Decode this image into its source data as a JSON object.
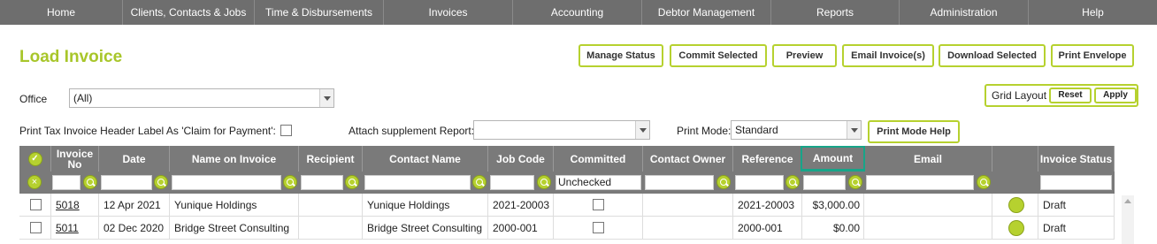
{
  "nav": [
    {
      "label": "Home",
      "w": 139
    },
    {
      "label": "Clients, Contacts & Jobs",
      "w": 149
    },
    {
      "label": "Time & Disbursements",
      "w": 146
    },
    {
      "label": "Invoices",
      "w": 146
    },
    {
      "label": "Accounting",
      "w": 146
    },
    {
      "label": "Debtor Management",
      "w": 146
    },
    {
      "label": "Reports",
      "w": 145
    },
    {
      "label": "Administration",
      "w": 146
    },
    {
      "label": "Help",
      "w": 145
    }
  ],
  "page_title": "Load Invoice",
  "toolbar": {
    "manage_status": "Manage Status",
    "commit_selected": "Commit Selected",
    "preview": "Preview",
    "email_invoices": "Email Invoice(s)",
    "download_selected": "Download Selected",
    "print_envelope": "Print Envelope"
  },
  "grid_layout": {
    "label": "Grid Layout",
    "reset": "Reset",
    "apply": "Apply"
  },
  "filters": {
    "office_label": "Office",
    "office_value": "(All)",
    "claim_label": "Print Tax Invoice Header Label As 'Claim for Payment':",
    "supplement_label": "Attach supplement Report:",
    "supplement_value": "",
    "print_mode_label": "Print Mode:",
    "print_mode_value": "Standard",
    "print_mode_help": "Print Mode Help"
  },
  "grid": {
    "columns": [
      "",
      "Invoice No",
      "Date",
      "Name on Invoice",
      "Recipient",
      "Contact Name",
      "Job Code",
      "Committed",
      "Contact Owner",
      "Reference",
      "Amount",
      "Email",
      "",
      "Invoice Status"
    ],
    "committed_filter": "Unchecked",
    "rows": [
      {
        "invoice_no": "5018",
        "date": "12 Apr 2021",
        "name": "Yunique Holdings",
        "recipient": "",
        "contact": "Yunique Holdings",
        "job_code": "2021-20003",
        "committed": false,
        "owner": "",
        "reference": "2021-20003",
        "amount": "$3,000.00",
        "email": "",
        "status": "Draft"
      },
      {
        "invoice_no": "5011",
        "date": "02 Dec 2020",
        "name": "Bridge Street Consulting",
        "recipient": "",
        "contact": "Bridge Street Consulting",
        "job_code": "2000-001",
        "committed": false,
        "owner": "",
        "reference": "2000-001",
        "amount": "$0.00",
        "email": "",
        "status": "Draft"
      }
    ]
  },
  "colors": {
    "accent": "#b6d12f",
    "title": "#a8c62a",
    "nav_bg": "#6e6e6e",
    "header_bg": "#7a7a7a",
    "highlight": "#17a589"
  }
}
